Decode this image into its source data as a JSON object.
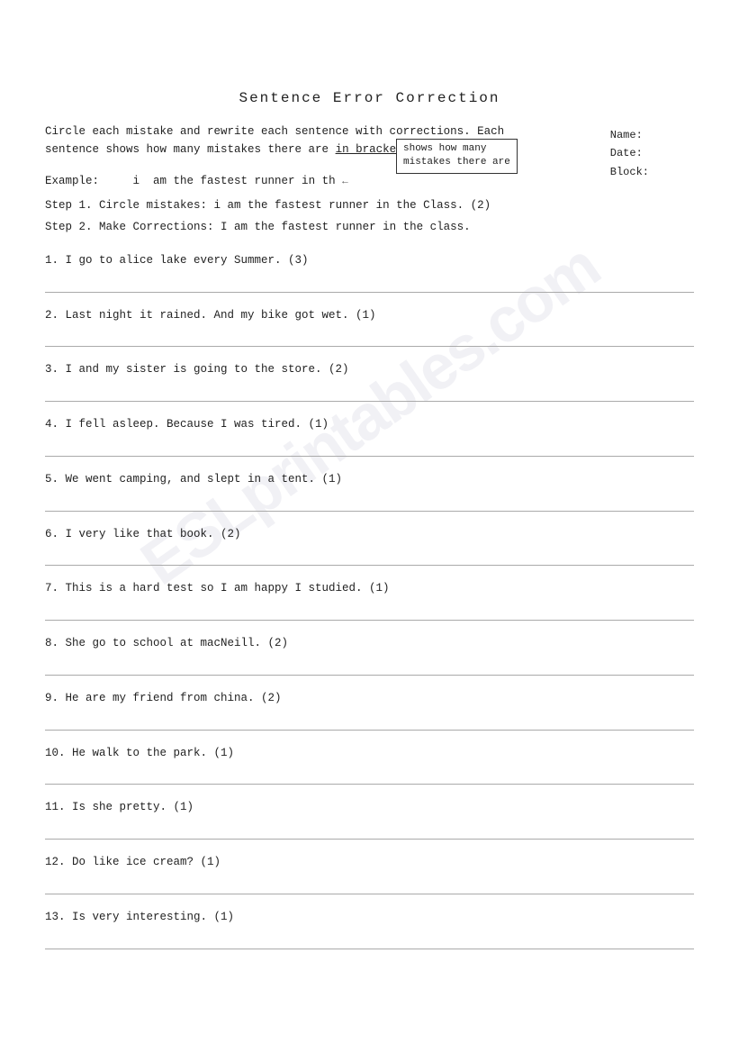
{
  "header": {
    "name_label": "Name:",
    "date_label": "Date:",
    "block_label": "Block:"
  },
  "title": "Sentence Error Correction",
  "instructions": {
    "line1": "Circle each mistake and rewrite each sentence with corrections. Each",
    "line2": "sentence shows how many mistakes there are",
    "line2b": "in brackets. (  )",
    "tooltip": "shows how many\nmistakes there are"
  },
  "example": {
    "label": "Example:",
    "text": "  i  am the fastest runner in th"
  },
  "step1": {
    "label": "Step 1. Circle mistakes:",
    "text": "  i  am the fastest runner in the Class. (2)"
  },
  "step2": {
    "label": "Step 2. Make Corrections:",
    "text": "  I am the fastest runner in the class."
  },
  "sentences": [
    {
      "num": "1.",
      "text": "I go to alice lake every Summer. (3)"
    },
    {
      "num": "2.",
      "text": "Last night it rained. And my bike got wet. (1)"
    },
    {
      "num": "3.",
      "text": "I and my sister is going to the store. (2)"
    },
    {
      "num": "4.",
      "text": "I fell asleep. Because I was tired. (1)"
    },
    {
      "num": "5.",
      "text": "We went camping, and slept in a tent. (1)"
    },
    {
      "num": "6.",
      "text": "I very like that book. (2)"
    },
    {
      "num": "7.",
      "text": "This is a hard test so I am happy I studied. (1)"
    },
    {
      "num": "8.",
      "text": "She go to school at macNeill. (2)"
    },
    {
      "num": "9.",
      "text": "He are my friend from china. (2)"
    },
    {
      "num": "10.",
      "text": "He walk to the park. (1)"
    },
    {
      "num": "11.",
      "text": "Is she pretty. (1)"
    },
    {
      "num": "12.",
      "text": "Do like ice cream? (1)"
    },
    {
      "num": "13.",
      "text": "Is very interesting. (1)"
    }
  ],
  "watermark": "ESLprintables.com"
}
